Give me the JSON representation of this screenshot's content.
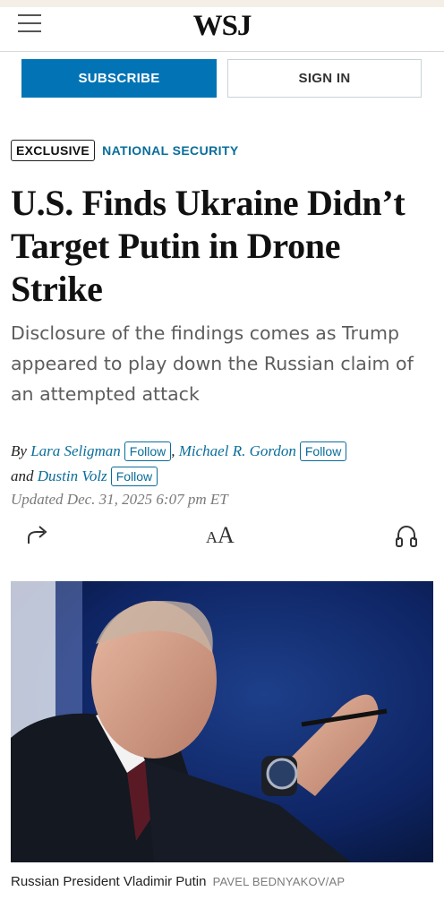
{
  "header": {
    "logo": "WSJ"
  },
  "auth": {
    "subscribe": "SUBSCRIBE",
    "sign_in": "SIGN IN"
  },
  "article": {
    "tag_exclusive": "EXCLUSIVE",
    "tag_section": "NATIONAL SECURITY",
    "headline": "U.S. Finds Ukraine Didn’t Target Putin in Drone Strike",
    "dek": "Disclosure of the findings comes as Trump appeared to play down the Russian claim of an attempted attack",
    "byline": {
      "by": "By",
      "author1": "Lara Seligman",
      "comma": ",",
      "author2": "Michael R. Gordon",
      "and": "and",
      "author3": "Dustin Volz",
      "follow": "Follow"
    },
    "updated": "Updated Dec. 31, 2025 6:07 pm ET",
    "tools": {
      "font_size": "A",
      "font_size_large": "A"
    },
    "image": {
      "caption": "Russian President Vladimir Putin",
      "credit": "PAVEL BEDNYAKOV/AP"
    }
  },
  "icons": [
    "menu-icon",
    "share-icon",
    "font-size-icon",
    "headphones-icon"
  ],
  "colors": {
    "accent": "#0274b6",
    "link": "#0a6d9a",
    "text": "#111111",
    "dek": "#5d5d5d"
  }
}
